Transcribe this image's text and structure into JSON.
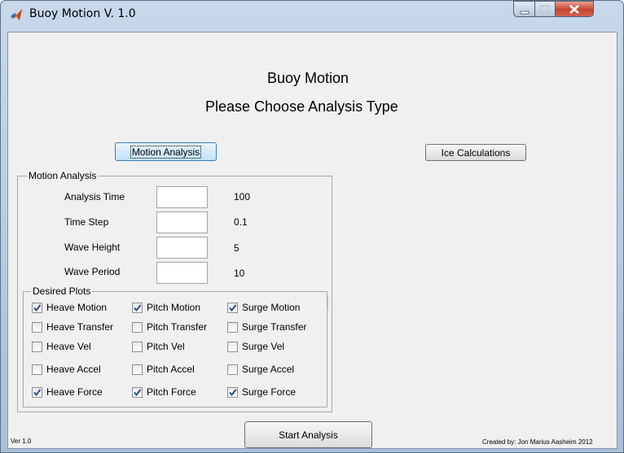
{
  "window": {
    "title": "Buoy Motion V. 1.0"
  },
  "header": {
    "title": "Buoy Motion",
    "subtitle": "Please Choose Analysis Type"
  },
  "buttons": {
    "motion_analysis": "Motion Analysis",
    "ice_calculations": "Ice Calculations",
    "start_analysis": "Start Analysis"
  },
  "motion_group": {
    "title": "Motion Analysis",
    "fields": [
      {
        "label": "Analysis Time",
        "value": "",
        "default": "100"
      },
      {
        "label": "Time Step",
        "value": "",
        "default": "0.1"
      },
      {
        "label": "Wave Height",
        "value": "",
        "default": "5"
      },
      {
        "label": "Wave Period",
        "value": "",
        "default": "10"
      }
    ]
  },
  "plots_group": {
    "title": "Desired Plots",
    "rows": [
      [
        {
          "label": "Heave Motion",
          "checked": true
        },
        {
          "label": "Pitch Motion",
          "checked": true
        },
        {
          "label": "Surge Motion",
          "checked": true
        }
      ],
      [
        {
          "label": "Heave Transfer",
          "checked": false
        },
        {
          "label": "Pitch Transfer",
          "checked": false
        },
        {
          "label": "Surge Transfer",
          "checked": false
        }
      ],
      [
        {
          "label": "Heave Vel",
          "checked": false
        },
        {
          "label": "Pitch Vel",
          "checked": false
        },
        {
          "label": "Surge Vel",
          "checked": false
        }
      ],
      [
        {
          "label": "Heave Accel",
          "checked": false
        },
        {
          "label": "Pitch Accel",
          "checked": false
        },
        {
          "label": "Surge Accel",
          "checked": false
        }
      ],
      [
        {
          "label": "Heave Force",
          "checked": true
        },
        {
          "label": "Pitch Force",
          "checked": true
        },
        {
          "label": "Surge Force",
          "checked": true
        }
      ]
    ]
  },
  "footer": {
    "version": "Ver 1.0",
    "credit": "Created by: Jon Marius Aasheim 2012"
  },
  "colors": {
    "accent_focus": "#bfe2f8",
    "close_button": "#c5452f"
  },
  "icons": {
    "app": "matlab-icon",
    "minimize": "minimize-icon",
    "maximize": "maximize-icon",
    "close": "close-icon"
  }
}
